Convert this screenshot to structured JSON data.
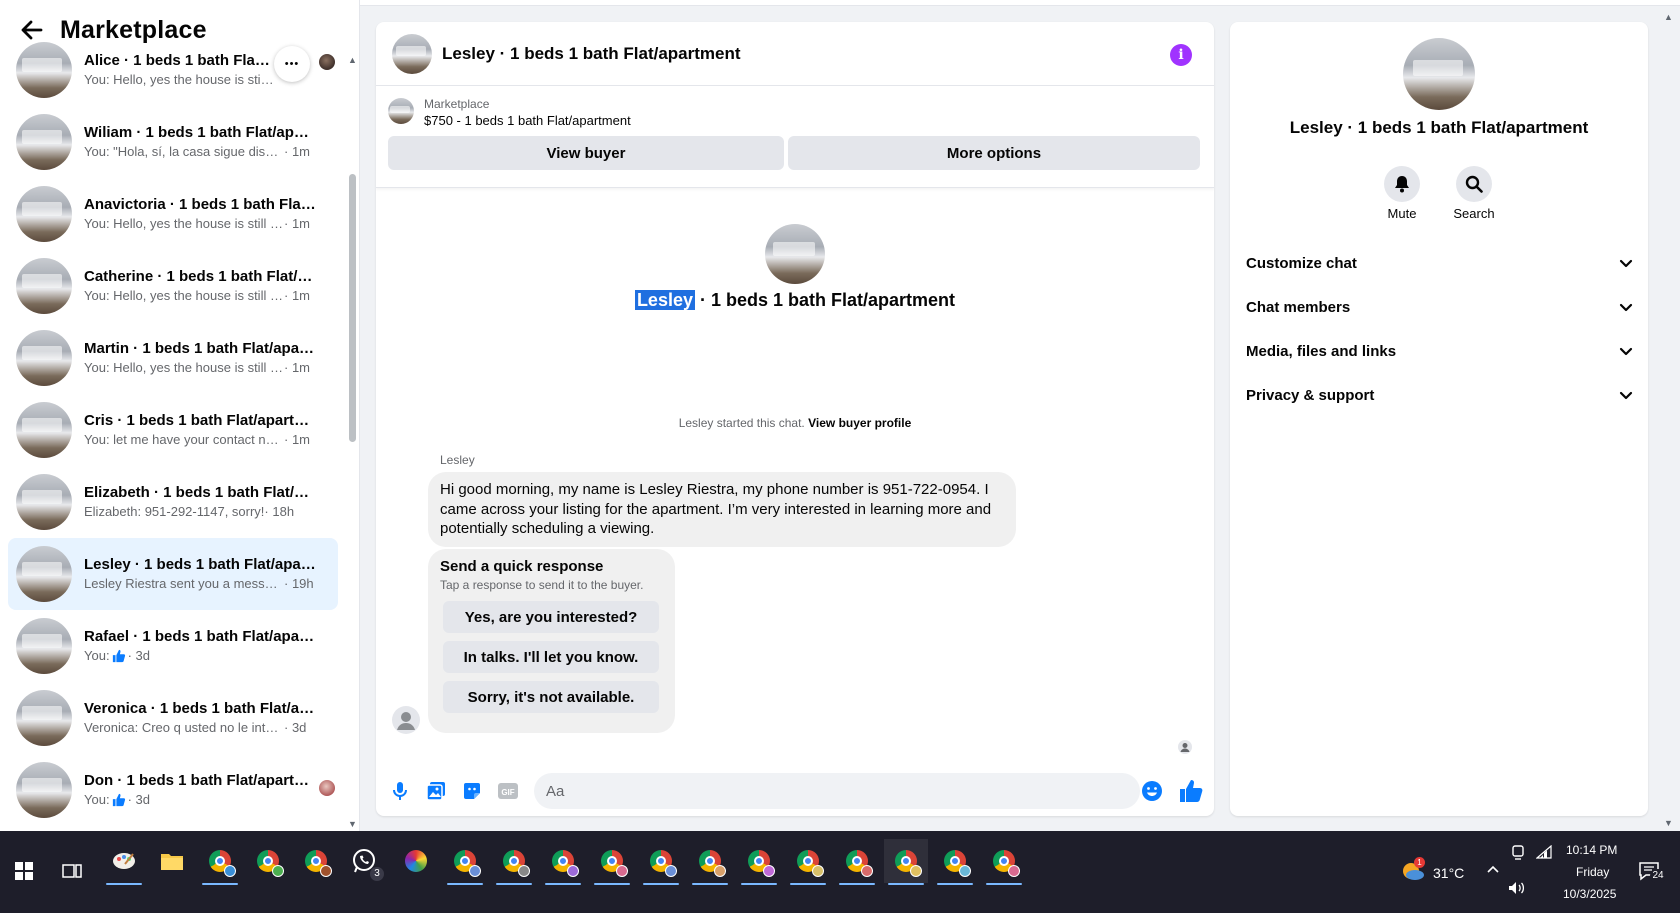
{
  "sidebar": {
    "title": "Marketplace",
    "conversations": [
      {
        "name": "Alice · 1 beds 1 bath Flat/apartment",
        "snippet": "You: Hello, yes the house is still available",
        "time": "",
        "thumb": false
      },
      {
        "name": "Wiliam · 1 beds 1 bath Flat/apartment",
        "snippet": "You: \"Hola, sí, la casa sigue disponible",
        "time": "· 1m",
        "thumb": false
      },
      {
        "name": "Anavictoria · 1 beds 1 bath Flat/apartment",
        "snippet": "You: Hello, yes the house is still available",
        "time": "· 1m",
        "thumb": false
      },
      {
        "name": "Catherine · 1 beds 1 bath Flat/apartment",
        "snippet": "You: Hello, yes the house is still available",
        "time": "· 1m",
        "thumb": false
      },
      {
        "name": "Martin · 1 beds 1 bath Flat/apartment",
        "snippet": "You: Hello, yes the house is still available",
        "time": "· 1m",
        "thumb": false
      },
      {
        "name": "Cris · 1 beds 1 bath Flat/apartment",
        "snippet": "You: let me have your contact number",
        "time": "· 1m",
        "thumb": false
      },
      {
        "name": "Elizabeth · 1 beds 1 bath Flat/apartment",
        "snippet": "Elizabeth: 951-292-1147, sorry!",
        "time": "· 18h",
        "thumb": false
      },
      {
        "name": "Lesley · 1 beds 1 bath Flat/apartment",
        "snippet": "Lesley Riestra sent you a message about your listing",
        "time": "· 19h",
        "thumb": false
      },
      {
        "name": "Rafael · 1 beds 1 bath Flat/apartment",
        "snippet": "You:",
        "time": "· 3d",
        "thumb": true
      },
      {
        "name": "Veronica · 1 beds 1 bath Flat/apartment",
        "snippet": "Veronica: Creo q usted no le interesa",
        "time": "· 3d",
        "thumb": false
      },
      {
        "name": "Don · 1 beds 1 bath Flat/apartment",
        "snippet": "You:",
        "time": "· 3d",
        "thumb": true
      }
    ],
    "more_glyph": "•••"
  },
  "chat": {
    "header_title": "Lesley · 1 beds 1 bath Flat/apartment",
    "info_glyph": "i",
    "listing_label": "Marketplace",
    "listing_price": "$750 - 1 beds 1 bath Flat/apartment",
    "view_buyer_label": "View buyer",
    "more_options_label": "More options",
    "intro_name_highlight": "Lesley",
    "intro_name_rest": " · 1 beds 1 bath Flat/apartment",
    "started_text": "Lesley started this chat.",
    "started_link": "View buyer profile",
    "sender_name": "Lesley",
    "message": "Hi good morning, my name is Lesley Riestra, my phone number is 951-722-0954. I came across your listing for the apartment. I’m very interested in learning more and potentially scheduling a viewing.",
    "quick_title": "Send a quick response",
    "quick_subtitle": "Tap a response to send it to the buyer.",
    "quick_responses": [
      "Yes, are you interested?",
      "In talks. I'll let you know.",
      "Sorry, it's not available."
    ],
    "composer_placeholder": "Aa",
    "gif_label": "GIF"
  },
  "details": {
    "name": "Lesley · 1 beds 1 bath Flat/apartment",
    "mute_label": "Mute",
    "search_label": "Search",
    "sections": [
      "Customize chat",
      "Chat members",
      "Media, files and links",
      "Privacy & support"
    ]
  },
  "taskbar": {
    "whatsapp_badge": "3",
    "weather_temp": "31°C",
    "weather_badge": "1",
    "time": "10:14 PM",
    "day": "Friday",
    "date": "10/3/2025",
    "notification_count": "24"
  },
  "colors": {
    "accent_purple": "#a033ff",
    "messenger_blue": "#0a7cff",
    "active_conversation_bg": "#e7f3ff",
    "highlight_blue": "#1f6fe0"
  }
}
